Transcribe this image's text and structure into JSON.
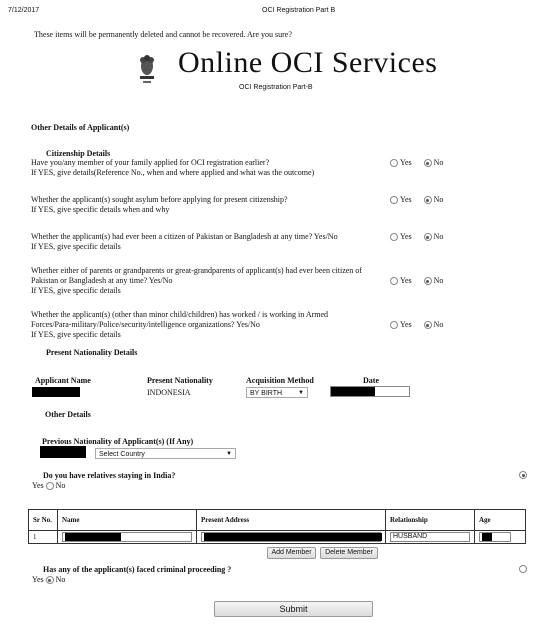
{
  "print_header": {
    "date": "7/12/2017",
    "title": "OCI Registration Part B"
  },
  "confirm_text": "These items will be permanently deleted and cannot be recovered. Are you sure?",
  "brand": {
    "title": "Online OCI Services",
    "subtitle": "OCI Registration Part-B"
  },
  "section_title": "Other Details of Applicant(s)",
  "citizenship": {
    "heading": "Citizenship Details",
    "yes_label": "Yes",
    "no_label": "No",
    "questions": [
      {
        "line1": "Have you/any member of your family applied for OCI registration earlier?",
        "line2": "If YES, give details(Reference No., when and where applied and what was the outcome)",
        "line3": "",
        "answer": "No"
      },
      {
        "line1": "Whether the applicant(s) sought asylum before applying for present citizenship?",
        "line2": "If YES, give specific details when and why",
        "line3": "",
        "answer": "No"
      },
      {
        "line1": "Whether the applicant(s) had ever been a citizen of Pakistan or Bangladesh at any time? Yes/No",
        "line2": "If YES, give specific details",
        "line3": "",
        "answer": "No"
      },
      {
        "line1": "Whether either of parents or grandparents or great-grandparents of applicant(s) had ever been citizen of",
        "line2": "Pakistan or Bangladesh at any time? Yes/No",
        "line3": "If YES, give specific details",
        "answer": "No"
      },
      {
        "line1": "Whether the applicant(s) (other than minor child/children) has worked / is working in Armed",
        "line2": "Forces/Para-military/Police/security/intelligence organizations? Yes/No",
        "line3": "If YES, give specific details",
        "answer": "No"
      }
    ]
  },
  "nationality": {
    "heading": "Present Nationality Details",
    "col_applicant": "Applicant Name",
    "col_nationality": "Present Nationality",
    "col_method": "Acquisition Method",
    "col_date": "Date",
    "nationality_value": "INDONESIA",
    "method_value": "BY BIRTH"
  },
  "other_details": {
    "heading": "Other Details",
    "prev_nationality_label": "Previous Nationality of Applicant(s) (If Any)",
    "country_placeholder": "Select Country"
  },
  "relatives": {
    "question": "Do you have relatives staying in India?",
    "yes_label": "Yes",
    "no_label": "No"
  },
  "members_table": {
    "headers": [
      "Sr No.",
      "Name",
      "Present Address",
      "Relationship",
      "Age"
    ],
    "row": {
      "sr": "1",
      "relationship": "HUSBAND"
    },
    "add_label": "Add Member",
    "delete_label": "Delete Member"
  },
  "criminal": {
    "question": "Has any of the applicant(s) faced criminal proceeding ?",
    "yes_label": "Yes",
    "no_label": "No"
  },
  "submit_label": "Submit"
}
